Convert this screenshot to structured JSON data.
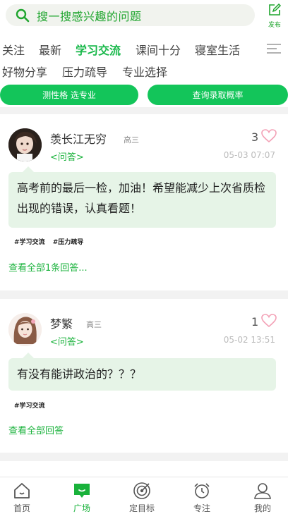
{
  "search": {
    "placeholder": "搜一搜感兴趣的问题"
  },
  "publish": {
    "label": "发布"
  },
  "tabs": {
    "row1": [
      "关注",
      "最新",
      "学习交流",
      "课间十分",
      "寝室生活"
    ],
    "row2": [
      "好物分享",
      "压力疏导",
      "专业选择"
    ],
    "active": "学习交流"
  },
  "actions": {
    "left": "测性格 选专业",
    "right": "查询录取概率"
  },
  "posts": [
    {
      "user": "羡长江无穷",
      "grade": "高三",
      "type": "<问答>",
      "likes": "3",
      "time": "05-03 07:07",
      "content": "高考前的最后一检，加油！希望能减少上次省质检出现的错误，认真看题！",
      "tags": [
        "#学习交流",
        "#压力疏导"
      ],
      "more": "查看全部1条回答..."
    },
    {
      "user": "梦繁",
      "grade": "高三",
      "type": "<问答>",
      "likes": "1",
      "time": "05-02 13:51",
      "content": "有没有能讲政治的？？？",
      "tags": [
        "#学习交流"
      ],
      "more": "查看全部回答"
    }
  ],
  "nav": [
    {
      "label": "首页",
      "icon": "home-icon"
    },
    {
      "label": "广场",
      "icon": "chat-square-icon",
      "active": true
    },
    {
      "label": "定目标",
      "icon": "target-icon"
    },
    {
      "label": "专注",
      "icon": "alarm-clock-icon"
    },
    {
      "label": "我的",
      "icon": "user-icon"
    }
  ],
  "colors": {
    "accent": "#19b23b",
    "pill": "#13c55a",
    "bubble": "#e6f4e7"
  }
}
